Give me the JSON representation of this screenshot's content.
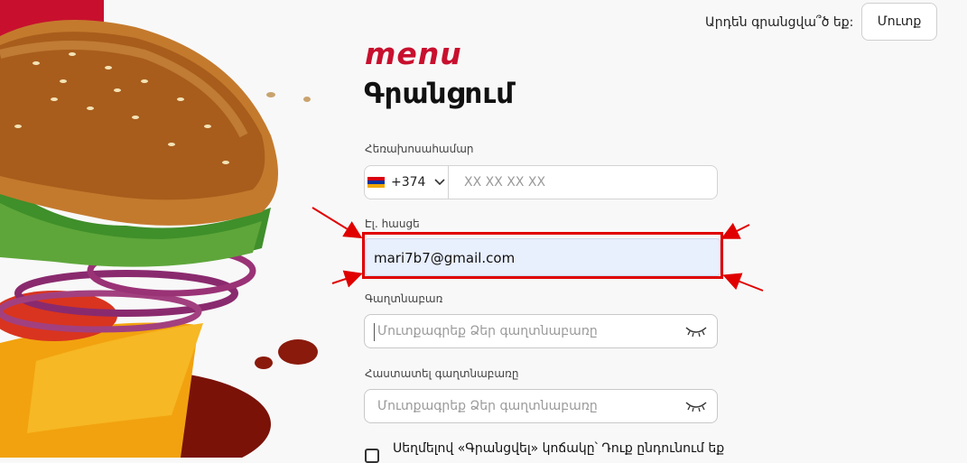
{
  "header": {
    "question": "Արդեն գրանցվա՞ծ եք:",
    "login_label": "Մուտք"
  },
  "logo": {
    "text": "menu",
    "color": "#c8102e"
  },
  "page_title": "Գրանցում",
  "phone": {
    "label": "Հեռախոսահամար",
    "country_code": "+374",
    "flag": "armenia-flag-icon",
    "placeholder": "XX XX XX XX"
  },
  "email": {
    "label": "Էլ. հասցե",
    "value": "mari7b7@gmail.com"
  },
  "password": {
    "label": "Գաղտնաբառ",
    "placeholder": "Մուտքագրեք Ձեր գաղտնաբառը",
    "toggle_icon": "eye-closed-icon"
  },
  "confirm_password": {
    "label": "Հաստատել գաղտնաբառը",
    "placeholder": "Մուտքագրեք Ձեր գաղտնաբառը",
    "toggle_icon": "eye-closed-icon"
  },
  "terms": {
    "text": "Սեղմելով «Գրանցվել» կոճակը՝ Դուք ընդունում եք"
  },
  "colors": {
    "brand": "#c8102e",
    "annotation": "#e00000",
    "email_fill": "#e8effd"
  }
}
